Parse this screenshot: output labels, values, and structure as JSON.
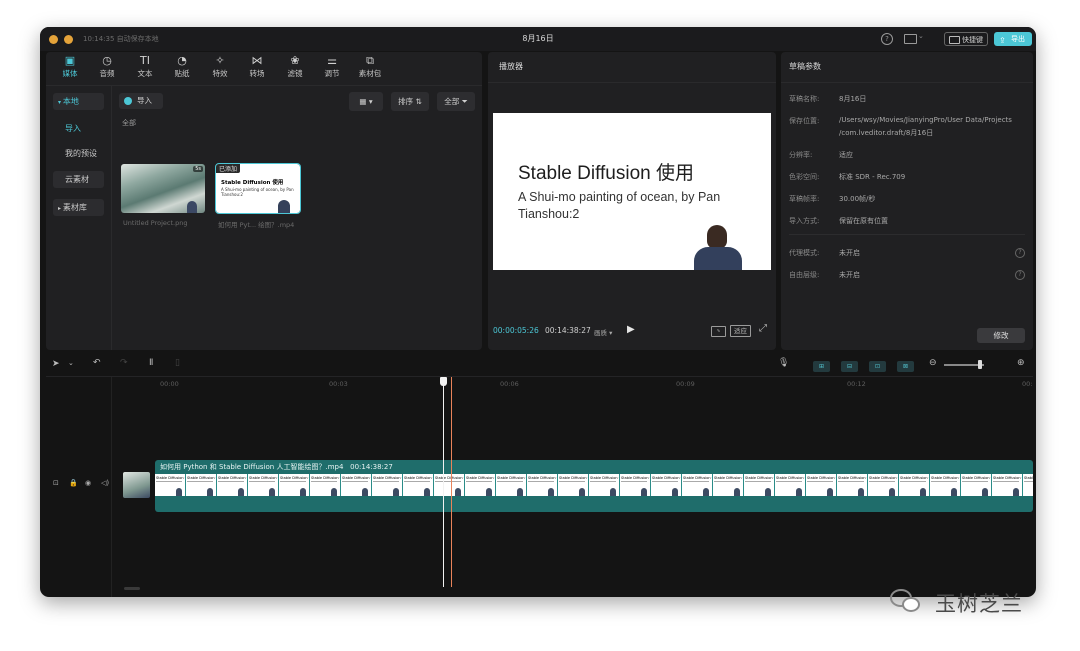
{
  "window": {
    "autosave_text": "10:14:35 自动保存本地",
    "title": "8月16日",
    "shortcut_label": "快捷键",
    "export_label": "导出"
  },
  "toolbar": {
    "items": [
      {
        "label": "媒体",
        "icon": "media-icon"
      },
      {
        "label": "音频",
        "icon": "audio-icon"
      },
      {
        "label": "文本",
        "icon": "text-icon"
      },
      {
        "label": "贴纸",
        "icon": "sticker-icon"
      },
      {
        "label": "特效",
        "icon": "effects-icon"
      },
      {
        "label": "转场",
        "icon": "transition-icon"
      },
      {
        "label": "滤镜",
        "icon": "filter-icon"
      },
      {
        "label": "调节",
        "icon": "adjust-icon"
      },
      {
        "label": "素材包",
        "icon": "material-pack-icon"
      }
    ]
  },
  "sidebar": {
    "items": [
      "本地",
      "导入",
      "我的预设",
      "云素材",
      "素材库"
    ]
  },
  "media": {
    "import_label": "导入",
    "sort_label": "排序",
    "filter_label": "全部",
    "all_label": "全部",
    "items": [
      {
        "name": "Untitled Project.png",
        "badge": "5s"
      },
      {
        "name": "如何用 Pyt... 绘图？.mp4",
        "badge": "已添加",
        "thumb_title": "Stable Diffusion 使用",
        "thumb_sub": "A Shui-mo painting of ocean, by Pan Tianshou:2"
      }
    ]
  },
  "player": {
    "header": "播放器",
    "slide_title": "Stable Diffusion 使用",
    "slide_sub": "A Shui-mo painting of ocean, by Pan Tianshou:2",
    "current_time": "00:00:05:26",
    "total_time": "00:14:38:27",
    "quality_label": "画质",
    "fit_label": "适应"
  },
  "params": {
    "header": "草稿参数",
    "rows": [
      {
        "label": "草稿名称:",
        "value": "8月16日"
      },
      {
        "label": "保存位置:",
        "value": "/Users/wsy/Movies/JianyingPro/User Data/Projects",
        "value2": "/com.lveditor.draft/8月16日"
      },
      {
        "label": "分辨率:",
        "value": "适应"
      },
      {
        "label": "色彩空间:",
        "value": "标准 SDR - Rec.709"
      },
      {
        "label": "草稿帧率:",
        "value": "30.00帧/秒"
      },
      {
        "label": "导入方式:",
        "value": "保留在原有位置"
      },
      {
        "label": "代理模式:",
        "value": "未开启"
      },
      {
        "label": "自由层级:",
        "value": "未开启"
      }
    ],
    "modify_label": "修改"
  },
  "timeline": {
    "ticks": [
      "00:00",
      "00:03",
      "00:06",
      "00:09",
      "00:12",
      "00:"
    ],
    "clip_name": "如何用 Python 和 Stable Diffusion 人工智能绘图？.mp4",
    "clip_duration": "00:14:38:27",
    "frame_text": "Stable Diffusion 使用",
    "playhead_fraction": 0.385
  },
  "watermark": {
    "text": "玉树芝兰"
  },
  "colors": {
    "accent": "#4cc7d6",
    "clip": "#1f6d6b",
    "playhead": "#e9835a"
  }
}
